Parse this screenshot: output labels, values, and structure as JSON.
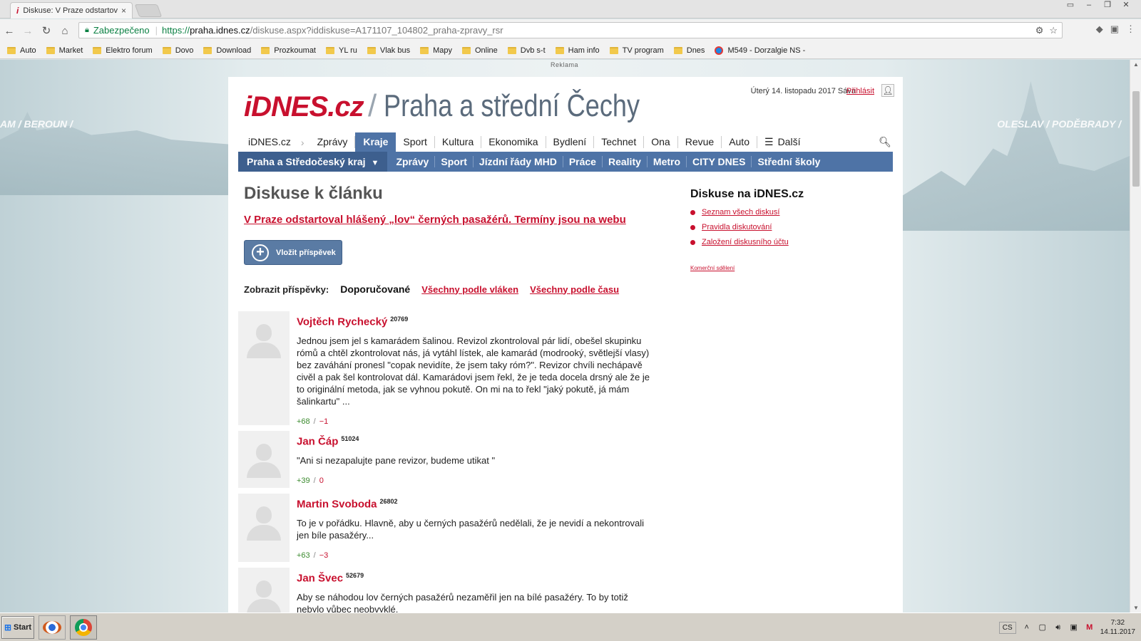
{
  "browser": {
    "tab_title": "Diskuse: V Praze odstartov",
    "tab_close": "×",
    "secure_label": "Zabezpečeno",
    "url_scheme": "https://",
    "url_host": "praha.idnes.cz",
    "url_path": "/diskuse.aspx?iddiskuse=A171107_104802_praha-zpravy_rsr",
    "bookmarks": [
      "Auto",
      "Market",
      "Elektro forum",
      "Dovo",
      "Download",
      "Prozkoumat",
      "YL ru",
      "Vlak bus",
      "Mapy",
      "Online",
      "Dvb s-t",
      "Ham info",
      "TV program",
      "Dnes"
    ],
    "bookmark_ns": "M549 - Dorzalgie NS -"
  },
  "ad_label": "Reklama",
  "bg_labels": {
    "left": "AM / BEROUN /",
    "right": "OLESLAV / PODĚBRADY /"
  },
  "header": {
    "logo": "iDNES.cz",
    "logo_sep": "/",
    "region_title": "Praha a střední Čechy",
    "date_line": "Úterý 14. listopadu 2017 Sáva",
    "login": "Přihlásit"
  },
  "mainnav": {
    "home": "iDNES.cz",
    "items": [
      "Zprávy",
      "Kraje",
      "Sport",
      "Kultura",
      "Ekonomika",
      "Bydlení",
      "Technet",
      "Ona",
      "Revue",
      "Auto"
    ],
    "more": "Další"
  },
  "subnav": {
    "region": "Praha a Středočeský kraj",
    "items": [
      "Zprávy",
      "Sport",
      "Jízdní řády MHD",
      "Práce",
      "Reality",
      "Metro",
      "CITY DNES",
      "Střední školy"
    ]
  },
  "main": {
    "heading": "Diskuse k článku",
    "article_link": "V Praze odstartoval hlášený „lov“ černých pasažérů. Termíny jsou na webu",
    "post_button": "Vložit příspěvek",
    "filter_label": "Zobrazit příspěvky:",
    "filter_active": "Doporučované",
    "filter_threads": "Všechny podle vláken",
    "filter_time": "Všechny podle času"
  },
  "posts": [
    {
      "author": "Vojtěch Rychecký",
      "count": "20769",
      "text": "Jednou jsem jel s kamarádem šalinou. Revizol zkontroloval pár lidí, obešel skupinku rómů a chtěl zkontrolovat nás, já vytáhl lístek, ale kamarád (modrooký, světlejší vlasy) bez zaváhání pronesl \"copak nevidíte, že jsem taky róm?\". Revizor chvíli nechápavě civěl a pak šel kontrolovat dál. Kamarádovi jsem řekl, že je teda docela drsný ale že je to originální metoda, jak se vyhnou pokutě. On mi na to řekl \"jaký pokutě, já mám šalinkartu\" ...",
      "up": "+68",
      "sep": "/",
      "down": "−1"
    },
    {
      "author": "Jan Čáp",
      "count": "51024",
      "text": "\"Ani si nezapalujte pane revizor, budeme utikat \"",
      "up": "+39",
      "sep": "/",
      "down": "0"
    },
    {
      "author": "Martin Svoboda",
      "count": "26802",
      "text": "To je v pořádku. Hlavně, aby u černých pasažérů nedělali, že je nevidí a nekontrovali jen bíle pasažéry...",
      "up": "+63",
      "sep": "/",
      "down": "−3"
    },
    {
      "author": "Jan Švec",
      "count": "52679",
      "text": "Aby se náhodou lov černých pasažérů nezaměřil jen na bílé pasažéry. To by totiž nebylo vůbec neobvyklé.",
      "up": "",
      "sep": "",
      "down": ""
    }
  ],
  "sidebar": {
    "title": "Diskuse na iDNES.cz",
    "links": [
      "Seznam všech diskusí",
      "Pravidla diskutování",
      "Založení diskusního účtu"
    ],
    "commercial": "Komerční sdělení"
  },
  "taskbar": {
    "start": "Start",
    "lang": "CS",
    "time": "7:32",
    "date": "14.11.2017"
  },
  "colors": {
    "brand": "#c8102e",
    "nav_blue": "#4e73a6"
  }
}
